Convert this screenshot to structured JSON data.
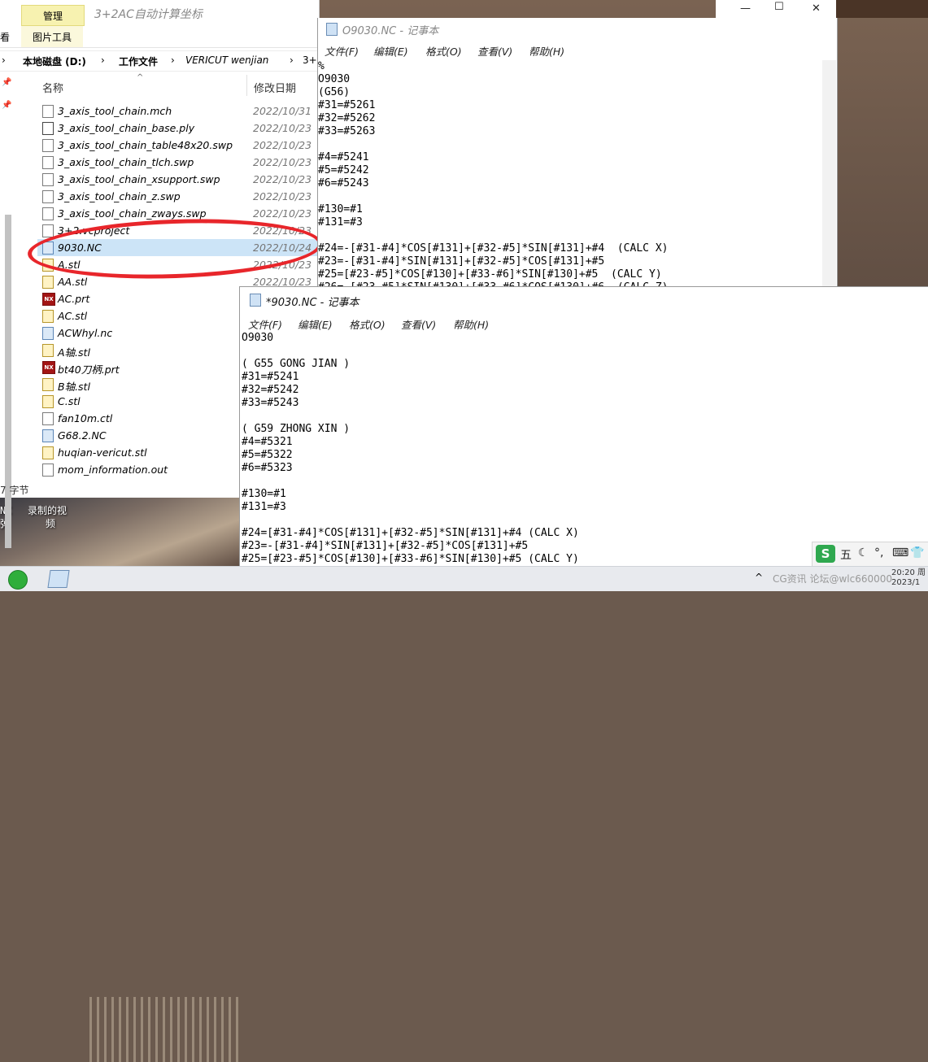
{
  "explorer": {
    "title": "3+2AC自动计算坐标",
    "ribbon": {
      "manage_tab": "管理",
      "view_label": "看",
      "picture_tools": "图片工具"
    },
    "address": [
      "本地磁盘 (D:)",
      "工作文件",
      "VERICUT wenjian",
      "3+"
    ],
    "columns": {
      "name": "名称",
      "date": "修改日期"
    },
    "files": [
      {
        "name": "3_axis_tool_chain.mch",
        "date": "2022/10/31",
        "icon": "file-icon",
        "extra": "1"
      },
      {
        "name": "3_axis_tool_chain_base.ply",
        "date": "2022/10/23",
        "icon": "ply-file-icon"
      },
      {
        "name": "3_axis_tool_chain_table48x20.swp",
        "date": "2022/10/23",
        "icon": "file-icon"
      },
      {
        "name": "3_axis_tool_chain_tlch.swp",
        "date": "2022/10/23",
        "icon": "file-icon"
      },
      {
        "name": "3_axis_tool_chain_xsupport.swp",
        "date": "2022/10/23",
        "icon": "file-icon"
      },
      {
        "name": "3_axis_tool_chain_z.swp",
        "date": "2022/10/23",
        "icon": "file-icon"
      },
      {
        "name": "3_axis_tool_chain_zways.swp",
        "date": "2022/10/23",
        "icon": "file-icon"
      },
      {
        "name": "3+2.vcproject",
        "date": "2022/10/23",
        "icon": "file-icon"
      },
      {
        "name": "9030.NC",
        "date": "2022/10/24",
        "icon": "nc-file-icon",
        "selected": true
      },
      {
        "name": "A.stl",
        "date": "2022/10/23",
        "icon": "stl-file-icon"
      },
      {
        "name": "AA.stl",
        "date": "2022/10/23",
        "icon": "stl-file-icon"
      },
      {
        "name": "AC.prt",
        "date": "",
        "icon": "nx-file-icon"
      },
      {
        "name": "AC.stl",
        "date": "",
        "icon": "stl-file-icon"
      },
      {
        "name": "ACWhyl.nc",
        "date": "",
        "icon": "nc-file-icon"
      },
      {
        "name": "A轴.stl",
        "date": "",
        "icon": "stl-file-icon"
      },
      {
        "name": "bt40刀柄.prt",
        "date": "",
        "icon": "nx-file-icon"
      },
      {
        "name": "B轴.stl",
        "date": "",
        "icon": "stl-file-icon"
      },
      {
        "name": "C.stl",
        "date": "",
        "icon": "stl-file-icon"
      },
      {
        "name": "fan10m.ctl",
        "date": "",
        "icon": "file-icon"
      },
      {
        "name": "G68.2.NC",
        "date": "",
        "icon": "nc-file-icon"
      },
      {
        "name": "huqian-vericut.stl",
        "date": "",
        "icon": "stl-file-icon"
      },
      {
        "name": "mom_information.out",
        "date": "",
        "icon": "file-icon"
      }
    ],
    "status": "字节"
  },
  "notepad1": {
    "title": "O9030.NC - 记事本",
    "menu": [
      "文件(F)",
      "编辑(E)",
      "格式(O)",
      "查看(V)",
      "帮助(H)"
    ],
    "content": "%\nO9030\n(G56)\n#31=#5261\n#32=#5262\n#33=#5263\n\n#4=#5241\n#5=#5242\n#6=#5243\n\n#130=#1\n#131=#3\n\n#24=-[#31-#4]*COS[#131]+[#32-#5]*SIN[#131]+#4  (CALC X)\n#23=-[#31-#4]*SIN[#131]+[#32-#5]*COS[#131]+#5\n#25=[#23-#5]*COS[#130]+[#33-#6]*SIN[#130]+#5  (CALC Y)\n#26=-[#23-#5]*SIN[#130]+[#33-#6]*COS[#130]+#6  (CALC Z)"
  },
  "notepad2": {
    "title": "*9030.NC - 记事本",
    "menu": [
      "文件(F)",
      "编辑(E)",
      "格式(O)",
      "查看(V)",
      "帮助(H)"
    ],
    "content": "O9030\n\n( G55 GONG JIAN )\n#31=#5241\n#32=#5242\n#33=#5243\n\n( G59 ZHONG XIN )\n#4=#5321\n#5=#5322\n#6=#5323\n\n#130=#1\n#131=#3\n\n#24=[#31-#4]*COS[#131]+[#32-#5]*SIN[#131]+#4 (CALC X)\n#23=-[#31-#4]*SIN[#131]+[#32-#5]*COS[#131]+#5\n#25=[#23-#5]*COS[#130]+[#33-#6]*SIN[#130]+#5 (CALC Y)"
  },
  "desktop": {
    "label_nc": "NC",
    "label_nc2": "弹",
    "label_video": "录制的视",
    "label_video2": "频"
  },
  "ime": {
    "mode": "五"
  },
  "taskbar": {
    "tray_text": "CG资讯 论坛@wlc660000",
    "clock_time": "20:20 周",
    "clock_date": "2023/1"
  }
}
